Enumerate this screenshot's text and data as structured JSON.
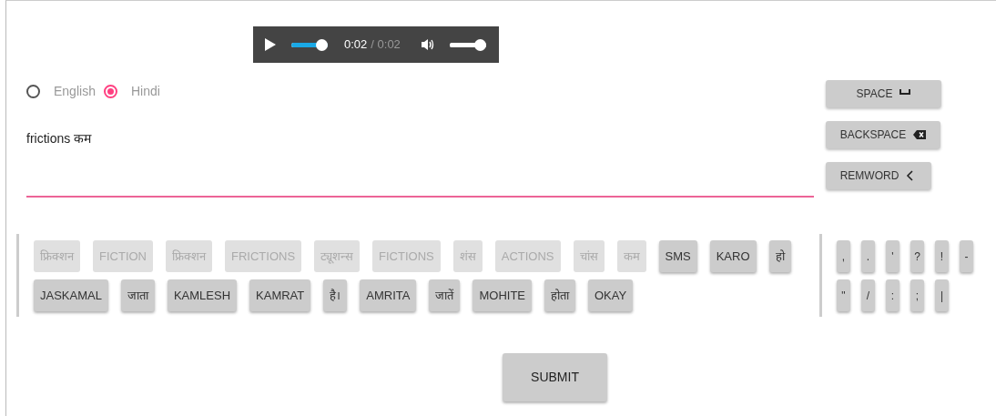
{
  "audio_player": {
    "playing": false,
    "progress": {
      "level": 1
    },
    "current_time": "0:02",
    "duration": "/ 0:02",
    "volume": {
      "level": 1
    }
  },
  "languages": [
    {
      "label": "English",
      "selected": false
    },
    {
      "label": "Hindi",
      "selected": true
    }
  ],
  "text_input": {
    "value": "frictions कम "
  },
  "edit_buttons": [
    {
      "label": "SPACE",
      "kind": "space"
    },
    {
      "label": "BACKSPACE",
      "kind": "backspace"
    },
    {
      "label": "REMWORD",
      "kind": "remword"
    }
  ],
  "suggestions": [
    {
      "label": "फ्रिक्शन",
      "disabled": true
    },
    {
      "label": "FICTION",
      "disabled": true
    },
    {
      "label": "फ्रिक्शन",
      "disabled": true
    },
    {
      "label": "FRICTIONS",
      "disabled": true
    },
    {
      "label": "ट्यूशन्स",
      "disabled": true
    },
    {
      "label": "FICTIONS",
      "disabled": true
    },
    {
      "label": "शंस",
      "disabled": true
    },
    {
      "label": "ACTIONS",
      "disabled": true
    },
    {
      "label": "चांस",
      "disabled": true
    },
    {
      "label": "कम",
      "disabled": true
    },
    {
      "label": "SMS",
      "disabled": false
    },
    {
      "label": "KARO",
      "disabled": false
    },
    {
      "label": "हो",
      "disabled": false
    },
    {
      "label": "JASKAMAL",
      "disabled": false
    },
    {
      "label": "जाता",
      "disabled": false
    },
    {
      "label": "KAMLESH",
      "disabled": false
    },
    {
      "label": "KAMRAT",
      "disabled": false
    },
    {
      "label": "है।",
      "disabled": false
    },
    {
      "label": "AMRITA",
      "disabled": false
    },
    {
      "label": "जातें",
      "disabled": false
    },
    {
      "label": "MOHITE",
      "disabled": false
    },
    {
      "label": "होता",
      "disabled": false
    },
    {
      "label": "OKAY",
      "disabled": false
    }
  ],
  "punctuation": [
    ",",
    ".",
    "'",
    "?",
    "!",
    "-",
    "\"",
    "/",
    ":",
    ";",
    "|"
  ],
  "submit_button": "SUBMIT"
}
